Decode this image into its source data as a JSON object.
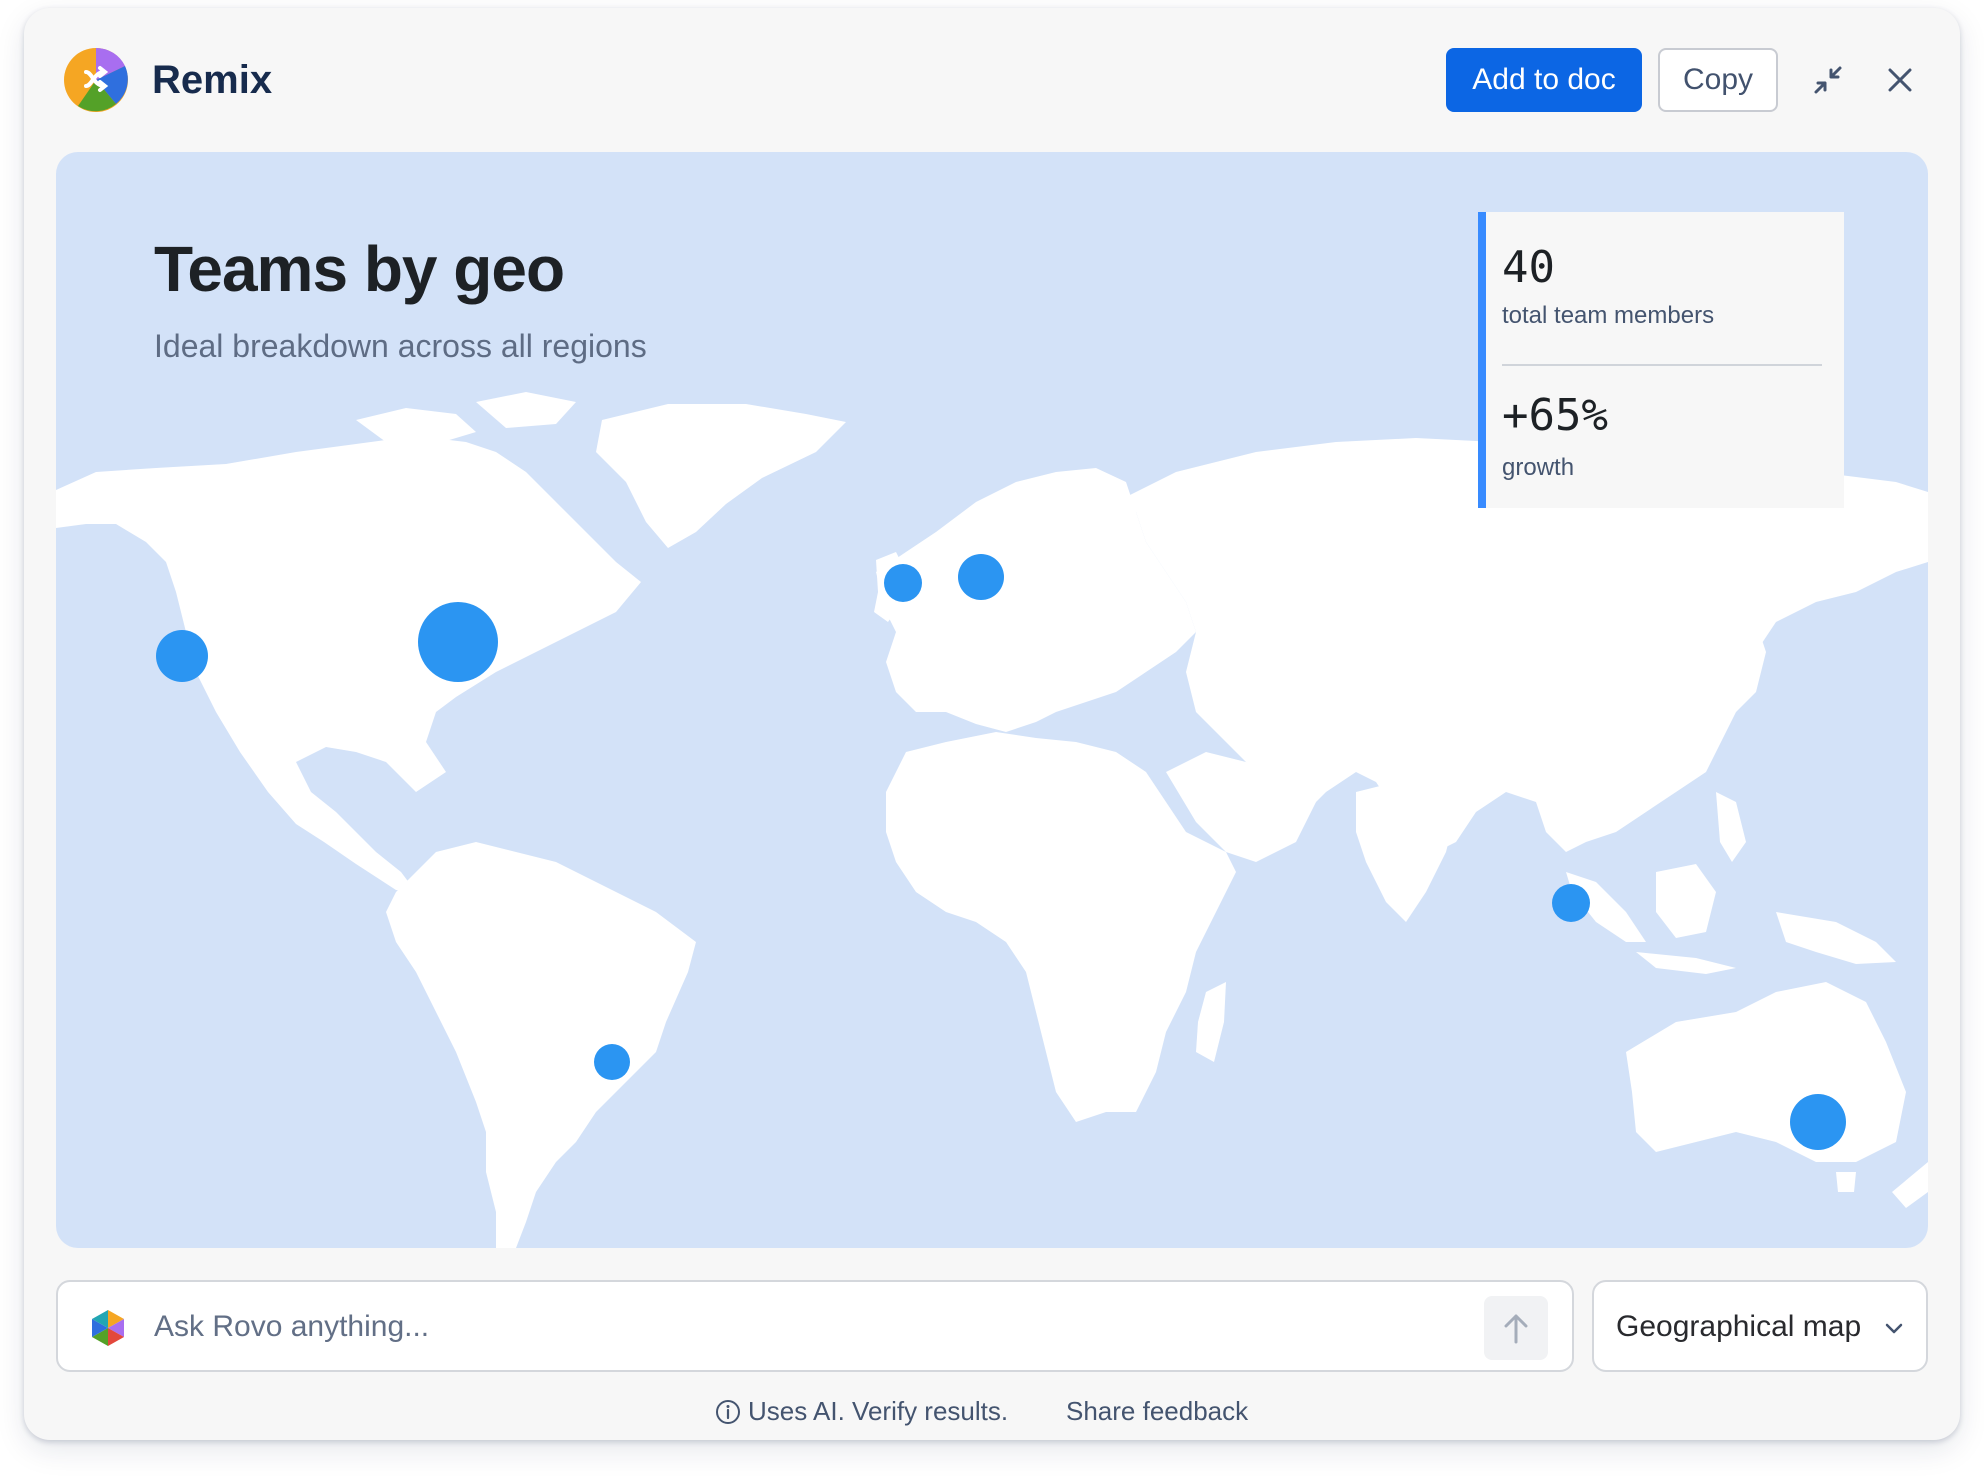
{
  "header": {
    "title": "Remix",
    "add_to_doc_label": "Add to doc",
    "copy_label": "Copy",
    "collapse_icon": "collapse-icon",
    "close_icon": "close-icon"
  },
  "map": {
    "title": "Teams by geo",
    "subtitle": "Ideal breakdown across all regions",
    "land_color": "#ffffff",
    "water_color": "#d3e2f8",
    "bubble_color": "#2b95f2",
    "locations": [
      {
        "name": "San Francisco",
        "lat": 37.8,
        "lon": -122.4,
        "relative_size": 0.7
      },
      {
        "name": "New York",
        "lat": 40.7,
        "lon": -74.0,
        "relative_size": 1.0
      },
      {
        "name": "London",
        "lat": 51.5,
        "lon": -0.1,
        "relative_size": 0.5
      },
      {
        "name": "Berlin",
        "lat": 52.5,
        "lon": 13.4,
        "relative_size": 0.6
      },
      {
        "name": "Singapore",
        "lat": 1.3,
        "lon": 103.8,
        "relative_size": 0.5
      },
      {
        "name": "Sao Paulo",
        "lat": -23.5,
        "lon": -46.6,
        "relative_size": 0.5
      },
      {
        "name": "Sydney",
        "lat": -33.9,
        "lon": 151.2,
        "relative_size": 0.75
      }
    ]
  },
  "stats": {
    "total_value": "40",
    "total_label": "total team members",
    "growth_value": "+65%",
    "growth_label": "growth"
  },
  "prompt": {
    "placeholder": "Ask Rovo anything...",
    "send_icon": "arrow-up-icon"
  },
  "visualization_select": {
    "selected": "Geographical map"
  },
  "footer": {
    "ai_note": "Uses AI. Verify results.",
    "feedback_label": "Share feedback"
  }
}
